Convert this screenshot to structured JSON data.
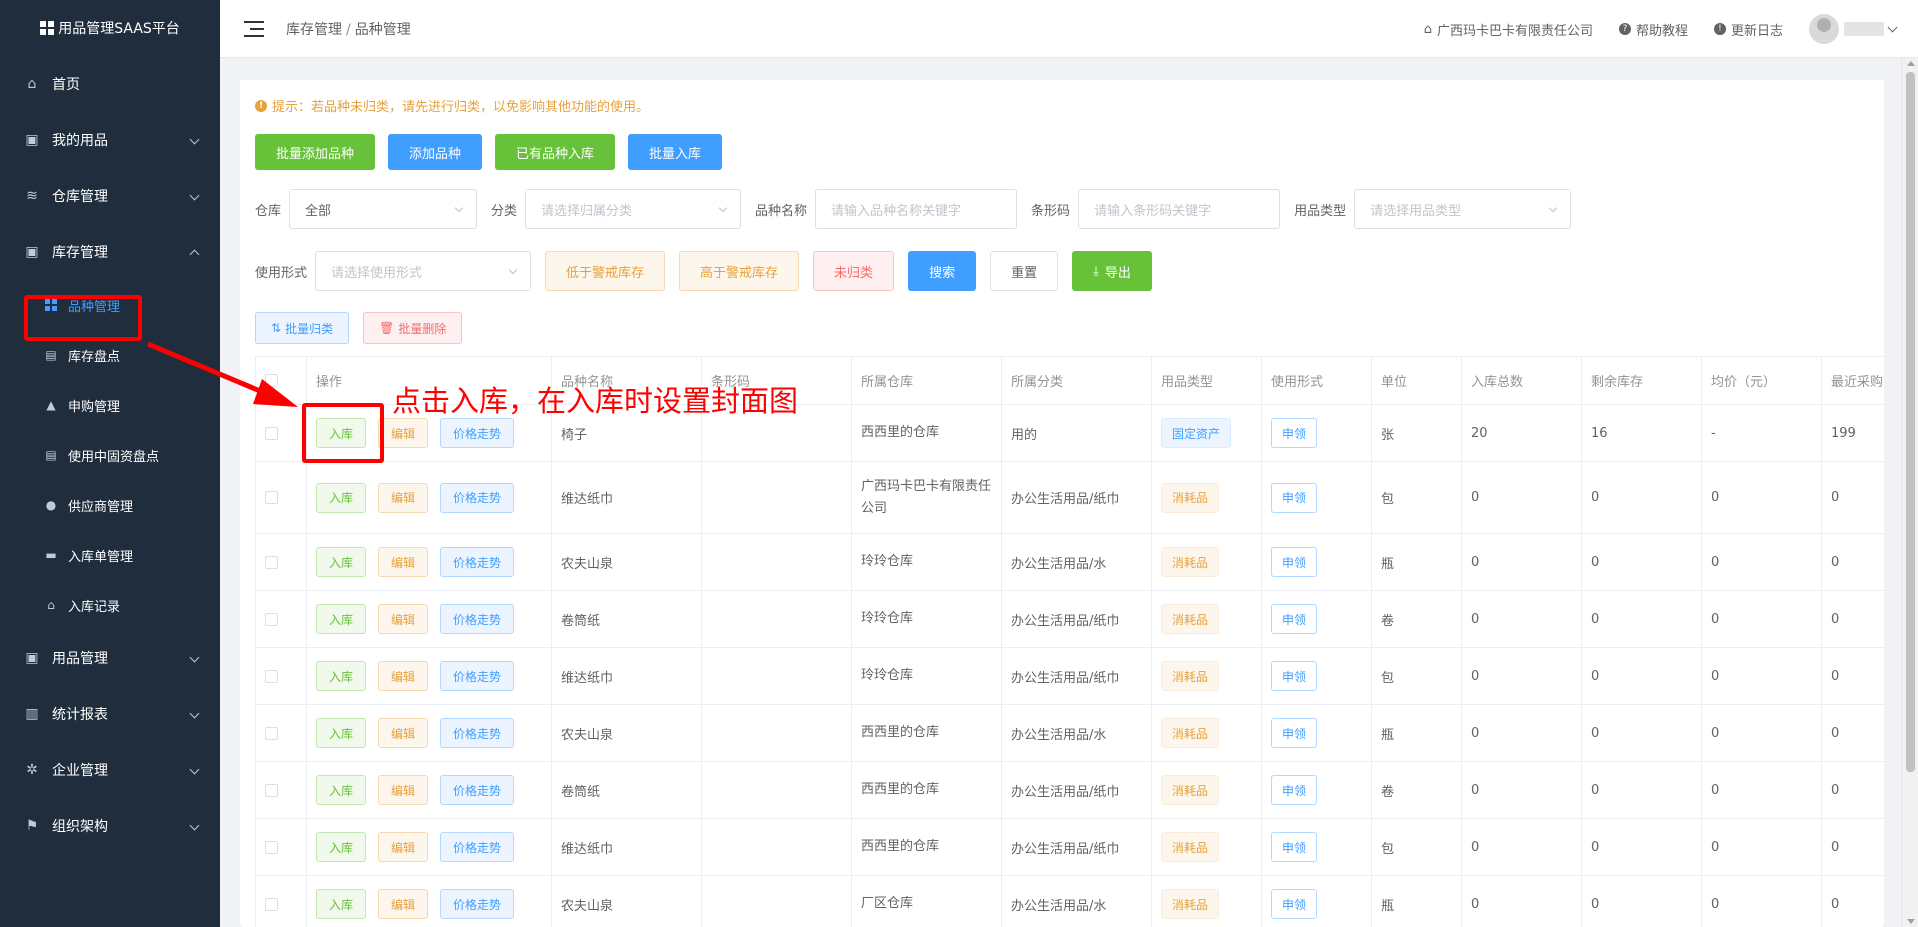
{
  "sidebar": {
    "logo_text": "用品管理SAAS平台",
    "menu": [
      {
        "label": "首页",
        "icon": "home-icon"
      },
      {
        "label": "我的用品",
        "icon": "bag-icon"
      },
      {
        "label": "仓库管理",
        "icon": "database-icon"
      },
      {
        "label": "库存管理",
        "icon": "bag-icon"
      }
    ],
    "sub_items": [
      {
        "label": "品种管理",
        "icon": "grid-icon"
      },
      {
        "label": "库存盘点",
        "icon": "document-icon"
      },
      {
        "label": "申购管理",
        "icon": "shopping-bag-icon"
      },
      {
        "label": "使用中固资盘点",
        "icon": "document-icon"
      },
      {
        "label": "供应商管理",
        "icon": "user-icon"
      },
      {
        "label": "入库单管理",
        "icon": "notebook-icon"
      },
      {
        "label": "入库记录",
        "icon": "home-icon"
      }
    ],
    "menu_bottom": [
      {
        "label": "用品管理",
        "icon": "bag-icon"
      },
      {
        "label": "统计报表",
        "icon": "bar-chart-icon"
      },
      {
        "label": "企业管理",
        "icon": "gear-icon"
      },
      {
        "label": "组织架构",
        "icon": "flag-icon"
      }
    ]
  },
  "header": {
    "breadcrumb": [
      "库存管理",
      "品种管理"
    ],
    "company": "广西玛卡巴卡有限责任公司",
    "help": "帮助教程",
    "changelog": "更新日志"
  },
  "main": {
    "tip": "提示：若品种未归类，请先进行归类，以免影响其他功能的使用。",
    "buttons": [
      "批量添加品种",
      "添加品种",
      "已有品种入库",
      "批量入库"
    ],
    "filters": {
      "warehouse_label": "仓库",
      "warehouse_value": "全部",
      "category_label": "分类",
      "category_placeholder": "请选择归属分类",
      "name_label": "品种名称",
      "name_placeholder": "请输入品种名称关键字",
      "barcode_label": "条形码",
      "barcode_placeholder": "请输入条形码关键字",
      "type_label": "用品类型",
      "type_placeholder": "请选择用品类型",
      "usage_label": "使用形式",
      "usage_placeholder": "请选择使用形式"
    },
    "filter_buttons": {
      "low_stock": "低于警戒库存",
      "high_stock": "高于警戒库存",
      "unclassified": "未归类",
      "search": "搜索",
      "reset": "重置",
      "export": "导出"
    },
    "batch_classify": "批量归类",
    "batch_delete": "批量删除",
    "annotation": "点击入库，在入库时设置封面图"
  },
  "table": {
    "columns": [
      "操作",
      "品种名称",
      "条形码",
      "所属仓库",
      "所属分类",
      "用品类型",
      "使用形式",
      "单位",
      "入库总数",
      "剩余库存",
      "均价（元）",
      "最近采购"
    ],
    "action_labels": {
      "in": "入库",
      "edit": "编辑",
      "price": "价格走势"
    },
    "rows": [
      {
        "name": "椅子",
        "barcode": "",
        "warehouse": "西西里的仓库",
        "category": "用的",
        "type": "固定资产",
        "type_kind": "fixed",
        "usage": "申领",
        "unit": "张",
        "total": "20",
        "remain": "16",
        "avg": "-",
        "recent": "199"
      },
      {
        "name": "维达纸巾",
        "barcode": "",
        "warehouse": "广西玛卡巴卡有限责任公司",
        "category": "办公生活用品/纸巾",
        "type": "消耗品",
        "type_kind": "cons",
        "usage": "申领",
        "unit": "包",
        "total": "0",
        "remain": "0",
        "avg": "0",
        "recent": "0"
      },
      {
        "name": "农夫山泉",
        "barcode": "",
        "warehouse": "玲玲仓库",
        "category": "办公生活用品/水",
        "type": "消耗品",
        "type_kind": "cons",
        "usage": "申领",
        "unit": "瓶",
        "total": "0",
        "remain": "0",
        "avg": "0",
        "recent": "0"
      },
      {
        "name": "卷筒纸",
        "barcode": "",
        "warehouse": "玲玲仓库",
        "category": "办公生活用品/纸巾",
        "type": "消耗品",
        "type_kind": "cons",
        "usage": "申领",
        "unit": "卷",
        "total": "0",
        "remain": "0",
        "avg": "0",
        "recent": "0"
      },
      {
        "name": "维达纸巾",
        "barcode": "",
        "warehouse": "玲玲仓库",
        "category": "办公生活用品/纸巾",
        "type": "消耗品",
        "type_kind": "cons",
        "usage": "申领",
        "unit": "包",
        "total": "0",
        "remain": "0",
        "avg": "0",
        "recent": "0"
      },
      {
        "name": "农夫山泉",
        "barcode": "",
        "warehouse": "西西里的仓库",
        "category": "办公生活用品/水",
        "type": "消耗品",
        "type_kind": "cons",
        "usage": "申领",
        "unit": "瓶",
        "total": "0",
        "remain": "0",
        "avg": "0",
        "recent": "0"
      },
      {
        "name": "卷筒纸",
        "barcode": "",
        "warehouse": "西西里的仓库",
        "category": "办公生活用品/纸巾",
        "type": "消耗品",
        "type_kind": "cons",
        "usage": "申领",
        "unit": "卷",
        "total": "0",
        "remain": "0",
        "avg": "0",
        "recent": "0"
      },
      {
        "name": "维达纸巾",
        "barcode": "",
        "warehouse": "西西里的仓库",
        "category": "办公生活用品/纸巾",
        "type": "消耗品",
        "type_kind": "cons",
        "usage": "申领",
        "unit": "包",
        "total": "0",
        "remain": "0",
        "avg": "0",
        "recent": "0"
      },
      {
        "name": "农夫山泉",
        "barcode": "",
        "warehouse": "厂区仓库",
        "category": "办公生活用品/水",
        "type": "消耗品",
        "type_kind": "cons",
        "usage": "申领",
        "unit": "瓶",
        "total": "0",
        "remain": "0",
        "avg": "0",
        "recent": "0"
      }
    ]
  },
  "colors": {
    "sidebar_bg": "#1f2d3d",
    "primary": "#409eff",
    "success": "#67c23a",
    "warning": "#e6a23c",
    "danger": "#f56c6c",
    "annotation": "#ff0000"
  }
}
